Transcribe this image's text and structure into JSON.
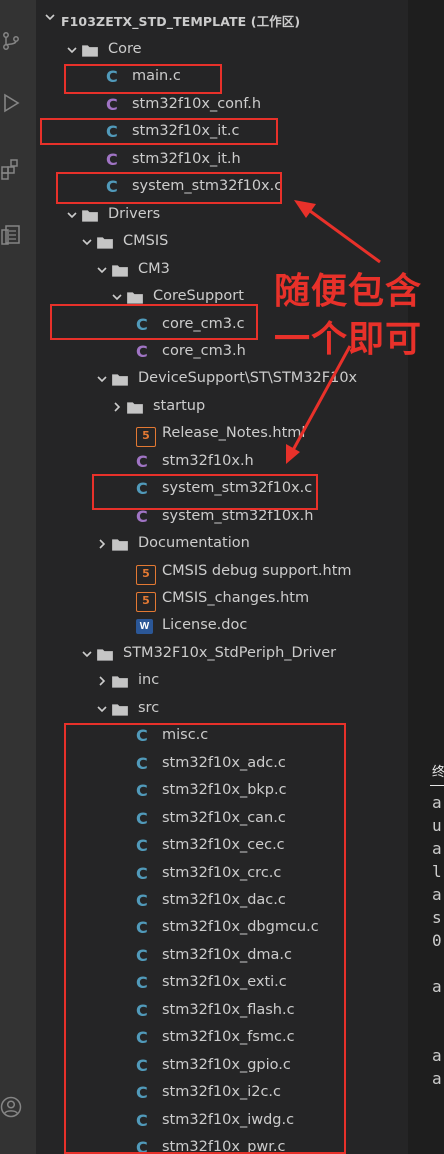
{
  "workspace_title": "F103ZETX_STD_TEMPLATE (工作区)",
  "annotation": {
    "line1": "随便包含",
    "line2": "一个即可"
  },
  "tree": [
    {
      "label": "Core",
      "kind": "folder",
      "open": true
    },
    {
      "label": "main.c",
      "kind": "c"
    },
    {
      "label": "stm32f10x_conf.h",
      "kind": "h"
    },
    {
      "label": "stm32f10x_it.c",
      "kind": "c"
    },
    {
      "label": "stm32f10x_it.h",
      "kind": "h"
    },
    {
      "label": "system_stm32f10x.c",
      "kind": "c"
    },
    {
      "label": "Drivers",
      "kind": "folder",
      "open": true
    },
    {
      "label": "CMSIS",
      "kind": "folder",
      "open": true
    },
    {
      "label": "CM3",
      "kind": "folder",
      "open": true
    },
    {
      "label": "CoreSupport",
      "kind": "folder",
      "open": true
    },
    {
      "label": "core_cm3.c",
      "kind": "c"
    },
    {
      "label": "core_cm3.h",
      "kind": "h"
    },
    {
      "label": "DeviceSupport\\ST\\STM32F10x",
      "kind": "folder",
      "open": true
    },
    {
      "label": "startup",
      "kind": "folder",
      "open": false
    },
    {
      "label": "Release_Notes.html",
      "kind": "html"
    },
    {
      "label": "stm32f10x.h",
      "kind": "h"
    },
    {
      "label": "system_stm32f10x.c",
      "kind": "c"
    },
    {
      "label": "system_stm32f10x.h",
      "kind": "h"
    },
    {
      "label": "Documentation",
      "kind": "folder",
      "open": false
    },
    {
      "label": "CMSIS debug support.htm",
      "kind": "html"
    },
    {
      "label": "CMSIS_changes.htm",
      "kind": "html"
    },
    {
      "label": "License.doc",
      "kind": "doc"
    },
    {
      "label": "STM32F10x_StdPeriph_Driver",
      "kind": "folder",
      "open": true
    },
    {
      "label": "inc",
      "kind": "folder",
      "open": false
    },
    {
      "label": "src",
      "kind": "folder",
      "open": true
    },
    {
      "label": "misc.c",
      "kind": "c"
    },
    {
      "label": "stm32f10x_adc.c",
      "kind": "c"
    },
    {
      "label": "stm32f10x_bkp.c",
      "kind": "c"
    },
    {
      "label": "stm32f10x_can.c",
      "kind": "c"
    },
    {
      "label": "stm32f10x_cec.c",
      "kind": "c"
    },
    {
      "label": "stm32f10x_crc.c",
      "kind": "c"
    },
    {
      "label": "stm32f10x_dac.c",
      "kind": "c"
    },
    {
      "label": "stm32f10x_dbgmcu.c",
      "kind": "c"
    },
    {
      "label": "stm32f10x_dma.c",
      "kind": "c"
    },
    {
      "label": "stm32f10x_exti.c",
      "kind": "c"
    },
    {
      "label": "stm32f10x_flash.c",
      "kind": "c"
    },
    {
      "label": "stm32f10x_fsmc.c",
      "kind": "c"
    },
    {
      "label": "stm32f10x_gpio.c",
      "kind": "c"
    },
    {
      "label": "stm32f10x_i2c.c",
      "kind": "c"
    },
    {
      "label": "stm32f10x_iwdg.c",
      "kind": "c"
    },
    {
      "label": "stm32f10x_pwr.c",
      "kind": "c"
    }
  ],
  "terminal": {
    "tab": "终",
    "lines": [
      "a",
      "u",
      "a",
      "l",
      "a",
      "s",
      "0",
      "",
      "a",
      "",
      "",
      "a",
      "a"
    ]
  },
  "colors": {
    "annotation_red": "#e8312a",
    "c_blue": "#519aba",
    "h_purple": "#a074c4",
    "html_orange": "#e37933"
  }
}
